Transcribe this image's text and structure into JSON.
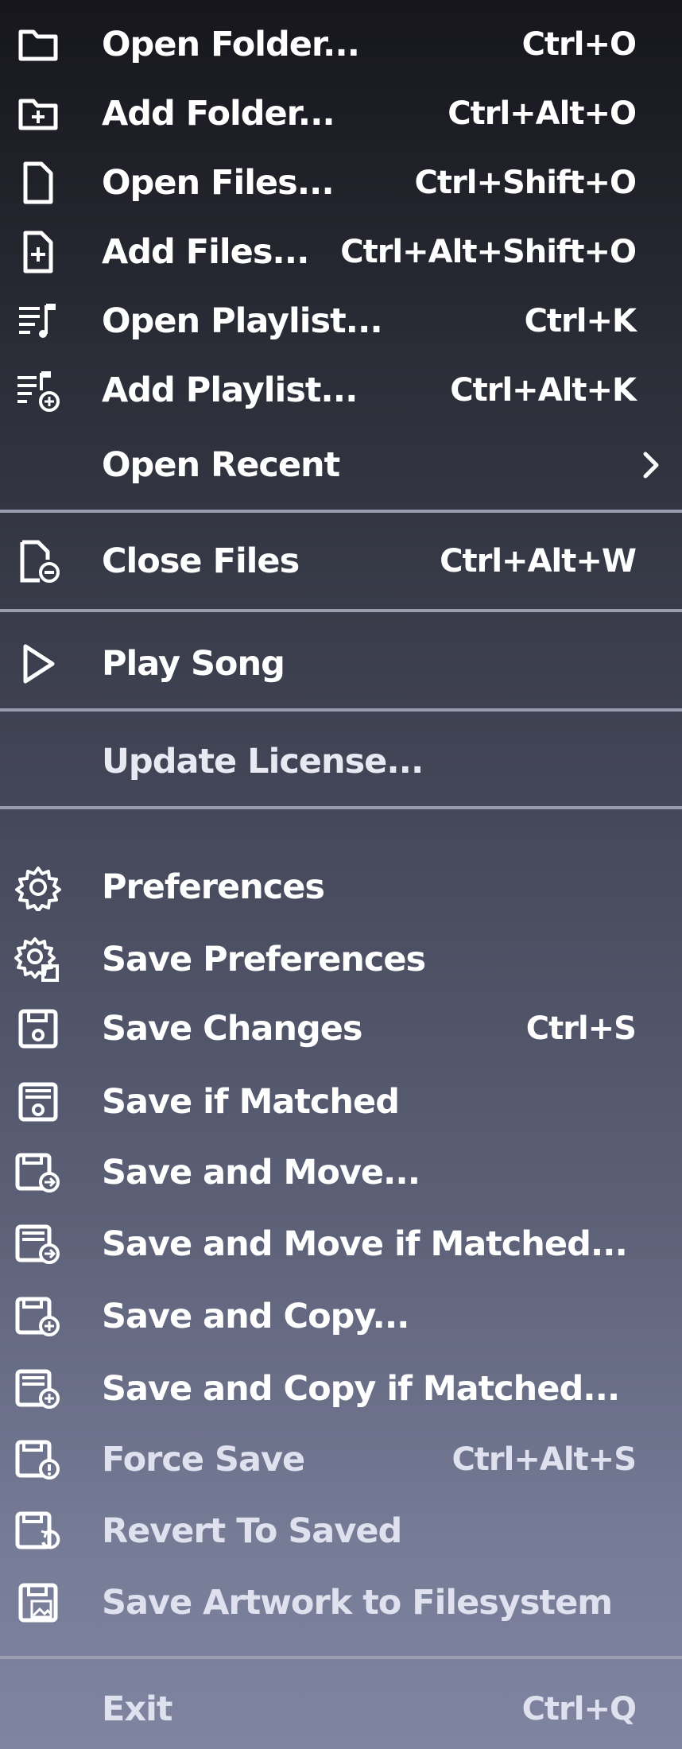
{
  "menu": {
    "items": [
      {
        "label": "Open Folder...",
        "shortcut": "Ctrl+O",
        "icon": "folder-icon"
      },
      {
        "label": "Add Folder...",
        "shortcut": "Ctrl+Alt+O",
        "icon": "folder-add-icon"
      },
      {
        "label": "Open Files...",
        "shortcut": "Ctrl+Shift+O",
        "icon": "file-icon"
      },
      {
        "label": "Add Files...",
        "shortcut": "Ctrl+Alt+Shift+O",
        "icon": "file-add-icon"
      },
      {
        "label": "Open Playlist...",
        "shortcut": "Ctrl+K",
        "icon": "playlist-icon"
      },
      {
        "label": "Add Playlist...",
        "shortcut": "Ctrl+Alt+K",
        "icon": "playlist-add-icon"
      },
      {
        "label": "Open Recent",
        "shortcut": "",
        "icon": "chevron-right-icon"
      },
      {
        "label": "Close Files",
        "shortcut": "Ctrl+Alt+W",
        "icon": "file-close-icon"
      },
      {
        "label": "Play Song",
        "shortcut": "",
        "icon": "play-icon"
      },
      {
        "label": "Update License...",
        "shortcut": "",
        "icon": ""
      },
      {
        "label": "Preferences",
        "shortcut": "",
        "icon": "gear-icon"
      },
      {
        "label": "Save Preferences",
        "shortcut": "",
        "icon": "gear-save-icon"
      },
      {
        "label": "Save Changes",
        "shortcut": "Ctrl+S",
        "icon": "save-icon"
      },
      {
        "label": "Save if Matched",
        "shortcut": "",
        "icon": "save-matched-icon"
      },
      {
        "label": "Save and Move...",
        "shortcut": "",
        "icon": "save-move-icon"
      },
      {
        "label": "Save and Move if Matched...",
        "shortcut": "",
        "icon": "save-move-matched-icon"
      },
      {
        "label": "Save and Copy...",
        "shortcut": "",
        "icon": "save-copy-icon"
      },
      {
        "label": "Save and Copy if Matched...",
        "shortcut": "",
        "icon": "save-copy-matched-icon"
      },
      {
        "label": "Force Save",
        "shortcut": "Ctrl+Alt+S",
        "icon": "force-save-icon"
      },
      {
        "label": "Revert To Saved",
        "shortcut": "",
        "icon": "revert-icon"
      },
      {
        "label": "Save Artwork to Filesystem",
        "shortcut": "",
        "icon": "save-artwork-icon"
      },
      {
        "label": "Exit",
        "shortcut": "Ctrl+Q",
        "icon": ""
      }
    ]
  }
}
